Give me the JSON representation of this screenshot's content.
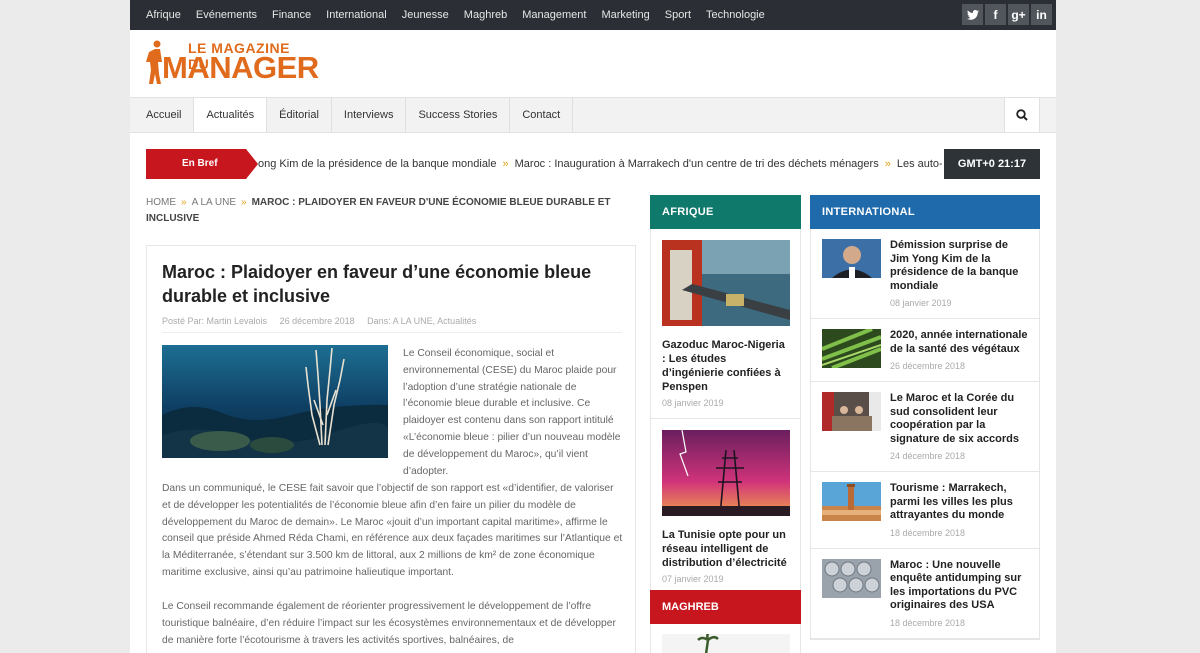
{
  "topnav": [
    "Afrique",
    "Evénements",
    "Finance",
    "International",
    "Jeunesse",
    "Maghreb",
    "Management",
    "Marketing",
    "Sport",
    "Technologie"
  ],
  "social": {
    "twitter": "t",
    "facebook": "f",
    "gplus": "g+",
    "linkedin": "in",
    "icons": [
      "twitter-icon",
      "facebook-icon",
      "google-plus-icon",
      "linkedin-icon"
    ]
  },
  "logo": {
    "line1": "LE MAGAZINE DU",
    "line2": "MANAGER"
  },
  "mainnav": [
    "Accueil",
    "Actualités",
    "Éditorial",
    "Interviews",
    "Success Stories",
    "Contact"
  ],
  "ticker": {
    "label": "En Bref",
    "items": [
      "ong Kim de la présidence de la banque mondiale",
      "Maroc : Inauguration à Marrakech d'un centre de tri des déchets ménagers",
      "Les auto-ent"
    ],
    "time": "GMT+0 21:17"
  },
  "breadcrumb": {
    "home": "HOME",
    "section": "A LA UNE",
    "current": "MAROC : PLAIDOYER EN FAVEUR D'UNE ÉCONOMIE BLEUE DURABLE ET INCLUSIVE"
  },
  "article": {
    "title": "Maroc : Plaidoyer en faveur d’une économie bleue durable et inclusive",
    "author": "Posté Par: Martin Levalois",
    "date": "26 décembre 2018",
    "categories": "Dans: A LA UNE, Actualités",
    "p1": "Le Conseil économique, social et environnemental (CESE) du Maroc plaide pour l’adoption d’une stratégie nationale de l’économie bleue durable et inclusive. Ce plaidoyer est contenu dans son rapport intitulé «L’économie bleue : pilier d’un nouveau modèle de développement du Maroc», qu’il vient d’adopter.",
    "p2": "Dans un communiqué, le CESE fait savoir que l’objectif de son rapport est «d’identifier, de valoriser et de développer les potentialités de l’économie bleue afin d’en faire un pilier du modèle de développement du Maroc de demain». Le Maroc «jouit d’un important capital maritime», affirme le conseil que préside Ahmed Réda Chami, en référence aux deux façades maritimes sur l’Atlantique et la Méditerranée, s’étendant sur 3.500 km de littoral, aux 2 millions de km² de zone économique maritime exclusive, ainsi qu’au patrimoine halieutique important.",
    "p3": "Le Conseil recommande également de réorienter progressivement le développement de l’offre touristique balnéaire, d’en réduire l’impact sur les écosystèmes environnementaux et de développer de manière forte l’écotourisme à travers les activités sportives, balnéaires, de"
  },
  "afrique": {
    "heading": "AFRIQUE",
    "color": "#0f7a6c",
    "items": [
      {
        "title": "Gazoduc Maroc-Nigeria : Les études d’ingénierie confiées à Penspen",
        "date": "08 janvier 2019"
      },
      {
        "title": "La Tunisie opte pour un réseau intelligent de distribution d’électricité",
        "date": "07 janvier 2019"
      }
    ]
  },
  "international": {
    "heading": "INTERNATIONAL",
    "color": "#1f6aab",
    "items": [
      {
        "title": "Démission surprise de Jim Yong Kim de la présidence de la banque mondiale",
        "date": "08 janvier 2019"
      },
      {
        "title": "2020, année internationale de la santé des végétaux",
        "date": "26 décembre 2018"
      },
      {
        "title": "Le Maroc et la Corée du sud consolident leur coopération par la signature de six accords",
        "date": "24 décembre 2018"
      },
      {
        "title": "Tourisme : Marrakech, parmi les villes les plus attrayantes du monde",
        "date": "18 décembre 2018"
      },
      {
        "title": "Maroc : Une nouvelle enquête antidumping sur les importations du PVC originaires des USA",
        "date": "18 décembre 2018"
      }
    ]
  },
  "maghreb": {
    "heading": "MAGHREB",
    "color": "#c7161d"
  }
}
